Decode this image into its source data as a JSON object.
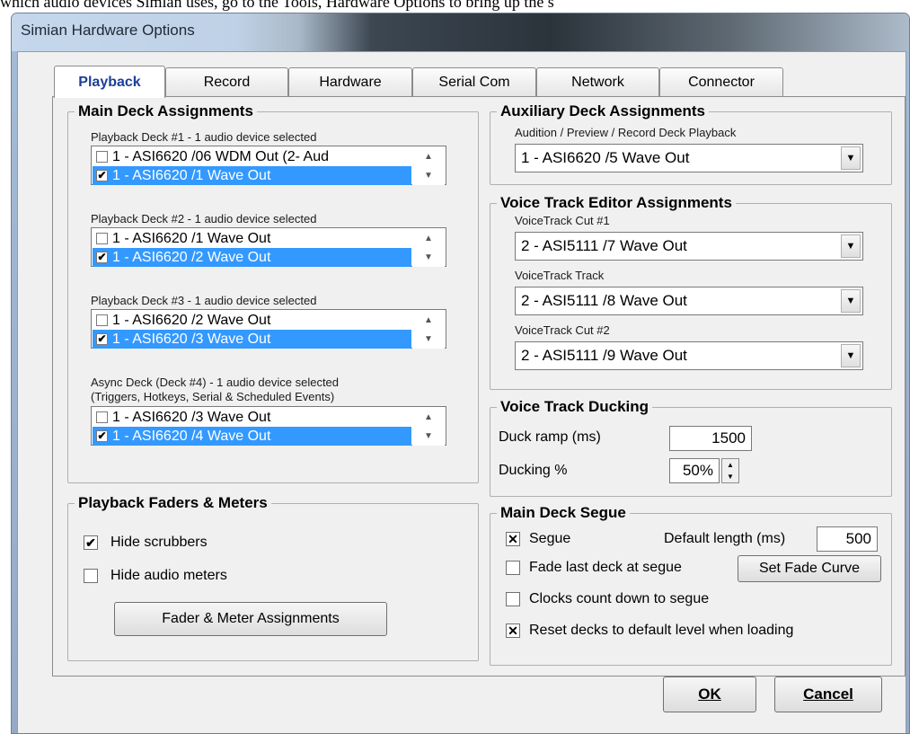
{
  "doc_text": "which audio devices Simian uses, go to the Tools, Hardware Options to bring up the s",
  "window": {
    "title": "Simian Hardware Options"
  },
  "tabs": [
    "Playback",
    "Record",
    "Hardware",
    "Serial Com",
    "Network",
    "Connector"
  ],
  "main_deck": {
    "title": "Main Deck Assignments",
    "decks": [
      {
        "caption": "Playback Deck #1 - 1 audio device selected",
        "items": [
          {
            "label": "1 - ASI6620 /06 WDM Out (2- Aud",
            "checked": false,
            "selected": false
          },
          {
            "label": "1 - ASI6620 /1 Wave Out",
            "checked": true,
            "selected": true
          }
        ]
      },
      {
        "caption": "Playback Deck #2 - 1 audio device selected",
        "items": [
          {
            "label": "1 - ASI6620 /1 Wave Out",
            "checked": false,
            "selected": false
          },
          {
            "label": "1 - ASI6620 /2 Wave Out",
            "checked": true,
            "selected": true
          }
        ]
      },
      {
        "caption": "Playback Deck #3 - 1 audio device selected",
        "items": [
          {
            "label": "1 - ASI6620 /2 Wave Out",
            "checked": false,
            "selected": false
          },
          {
            "label": "1 - ASI6620 /3 Wave Out",
            "checked": true,
            "selected": true
          }
        ]
      },
      {
        "caption": "Async Deck (Deck #4) - 1 audio device selected",
        "caption2": "(Triggers, Hotkeys, Serial & Scheduled Events)",
        "items": [
          {
            "label": "1 - ASI6620 /3 Wave Out",
            "checked": false,
            "selected": false
          },
          {
            "label": "1 - ASI6620 /4 Wave Out",
            "checked": true,
            "selected": true
          }
        ]
      }
    ]
  },
  "faders": {
    "title": "Playback Faders & Meters",
    "hide_scrubbers": {
      "label": "Hide scrubbers",
      "checked": true
    },
    "hide_meters": {
      "label": "Hide audio meters",
      "checked": false
    },
    "assign_button": "Fader & Meter Assignments"
  },
  "aux": {
    "title": "Auxiliary Deck Assignments",
    "caption": "Audition / Preview / Record Deck Playback",
    "value": "1 - ASI6620 /5 Wave Out"
  },
  "voice_editor": {
    "title": "Voice Track Editor Assignments",
    "cut1": {
      "caption": "VoiceTrack Cut #1",
      "value": "2 - ASI5111 /7 Wave Out"
    },
    "track": {
      "caption": "VoiceTrack Track",
      "value": "2 - ASI5111 /8 Wave Out"
    },
    "cut2": {
      "caption": "VoiceTrack Cut #2",
      "value": "2 - ASI5111 /9 Wave Out"
    }
  },
  "ducking": {
    "title": "Voice Track Ducking",
    "ramp_label": "Duck ramp (ms)",
    "ramp_value": "1500",
    "pct_label": "Ducking %",
    "pct_value": "50%"
  },
  "segue": {
    "title": "Main Deck Segue",
    "segue": {
      "label": "Segue",
      "checked": true
    },
    "default_length_label": "Default length (ms)",
    "default_length_value": "500",
    "fade_last": {
      "label": "Fade last deck at segue",
      "checked": false
    },
    "fade_curve_button": "Set Fade Curve",
    "clocks": {
      "label": "Clocks count down to segue",
      "checked": false
    },
    "reset": {
      "label": "Reset decks to default level when loading",
      "checked": true
    }
  },
  "buttons": {
    "ok": "OK",
    "cancel": "Cancel"
  }
}
